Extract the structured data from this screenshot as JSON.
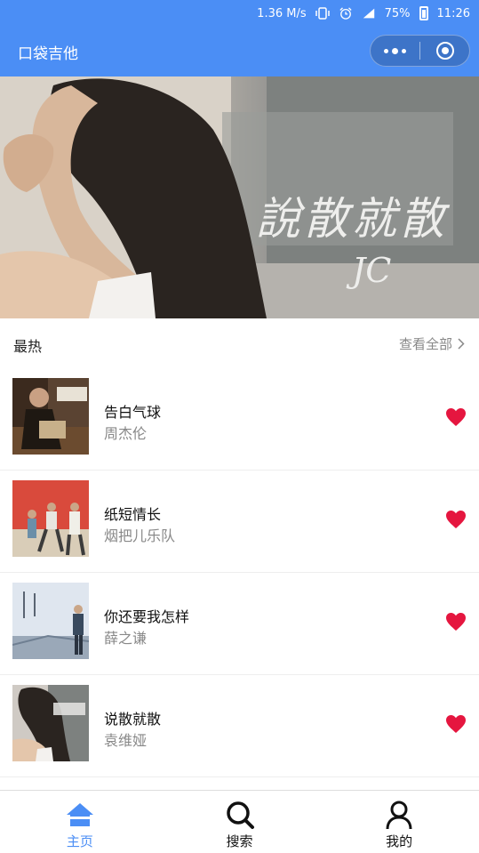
{
  "status_bar": {
    "network_speed": "1.36 M/s",
    "battery": "75%",
    "time": "11:26",
    "icons": [
      "vibrate-icon",
      "alarm-icon",
      "signal-icon",
      "battery-icon"
    ]
  },
  "navbar": {
    "title": "口袋吉他",
    "capsule": [
      "more-icon",
      "close-miniprogram-icon"
    ]
  },
  "banner": {
    "title": "說散就散",
    "artist": "JC"
  },
  "section": {
    "title": "最热",
    "view_all": "查看全部"
  },
  "songs": [
    {
      "name": "告白气球",
      "artist": "周杰伦"
    },
    {
      "name": "纸短情长",
      "artist": "烟把儿乐队"
    },
    {
      "name": "你还要我怎样",
      "artist": "薛之谦"
    },
    {
      "name": "说散就散",
      "artist": "袁维娅"
    }
  ],
  "tabbar": {
    "items": [
      {
        "label": "主页",
        "icon": "home-icon",
        "active": true
      },
      {
        "label": "搜索",
        "icon": "search-icon",
        "active": false
      },
      {
        "label": "我的",
        "icon": "user-icon",
        "active": false
      }
    ]
  },
  "colors": {
    "primary": "#4b8ef5",
    "heart": "#e5163f",
    "muted": "#888888"
  }
}
